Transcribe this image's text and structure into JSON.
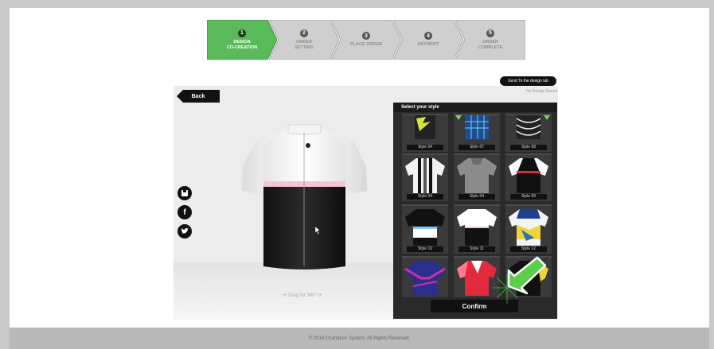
{
  "steps": [
    {
      "number": "1",
      "label": "DESIGN\nCO-CREATION",
      "active": true
    },
    {
      "number": "2",
      "label": "ORDER\nSETTING",
      "active": false
    },
    {
      "number": "3",
      "label": "PLACE ORDER",
      "active": false
    },
    {
      "number": "4",
      "label": "PAYMENT",
      "active": false
    },
    {
      "number": "5",
      "label": "ORDER\nCOMPLETE",
      "active": false
    }
  ],
  "designer": {
    "back_label": "Back",
    "design_lab_label": "Send To the design lab",
    "no_design_saved": "No Design Saved",
    "drag_hint": "Drag for 360°"
  },
  "style_panel": {
    "title": "Select your style",
    "confirm_label": "Confirm",
    "styles": [
      {
        "label": "Style 04"
      },
      {
        "label": "Style 07"
      },
      {
        "label": "Style 08"
      },
      {
        "label": "Style 04"
      },
      {
        "label": "Style 04"
      },
      {
        "label": "Style 09"
      },
      {
        "label": "Style 10"
      },
      {
        "label": "Style 11"
      },
      {
        "label": "Style 12"
      },
      {
        "label": ""
      },
      {
        "label": ""
      },
      {
        "label": ""
      }
    ]
  },
  "social": [
    {
      "icon": "save-icon"
    },
    {
      "icon": "facebook-icon"
    },
    {
      "icon": "twitter-icon"
    }
  ],
  "footer": {
    "copyright": "© 2014 Champion System. All Rights Reserved."
  },
  "colors": {
    "active_step": "#5aba5a",
    "inactive_step": "#cfcfcf",
    "cursor_arrow": "#52c242"
  }
}
